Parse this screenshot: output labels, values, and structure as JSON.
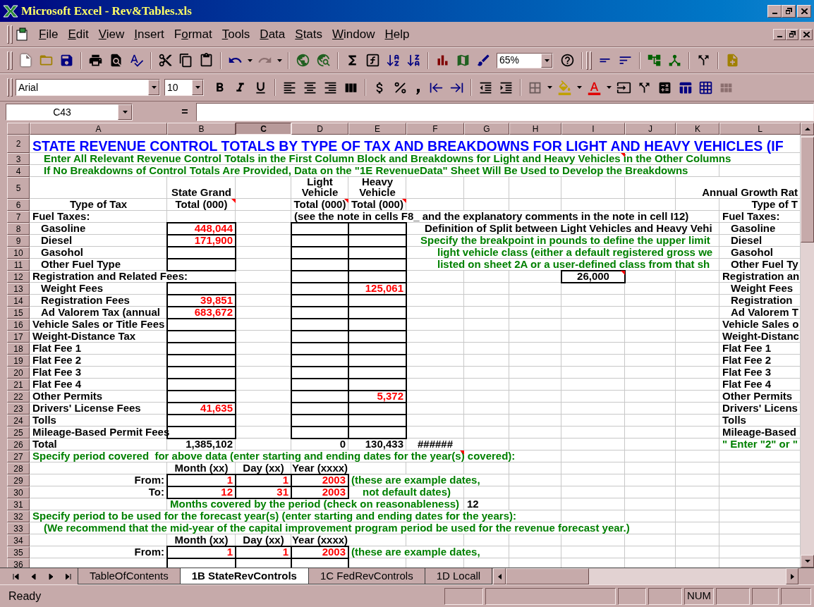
{
  "window": {
    "title": "Microsoft Excel - Rev&Tables.xls"
  },
  "menu": [
    {
      "key": "F",
      "post": "ile"
    },
    {
      "key": "E",
      "post": "dit"
    },
    {
      "key": "V",
      "post": "iew"
    },
    {
      "key": "I",
      "post": "nsert"
    },
    {
      "pre": "F",
      "key": "o",
      "post": "rmat"
    },
    {
      "key": "T",
      "post": "ools"
    },
    {
      "key": "D",
      "post": "ata"
    },
    {
      "key": "S",
      "post": "tats"
    },
    {
      "key": "W",
      "post": "indow"
    },
    {
      "key": "H",
      "post": "elp"
    }
  ],
  "standard_toolbar": {
    "zoom": "65%",
    "redo_disabled": true
  },
  "formatting_toolbar": {
    "font": "Arial",
    "size": "10"
  },
  "formula_bar": {
    "name_box": "C43",
    "edit_button": "="
  },
  "columns": [
    {
      "label": "A",
      "selected": false
    },
    {
      "label": "B",
      "selected": false
    },
    {
      "label": "C",
      "selected": true
    },
    {
      "label": "D",
      "selected": false
    },
    {
      "label": "E",
      "selected": false
    },
    {
      "label": "F",
      "selected": false
    },
    {
      "label": "G",
      "selected": false
    },
    {
      "label": "H",
      "selected": false
    },
    {
      "label": "I",
      "selected": false
    },
    {
      "label": "J",
      "selected": false
    },
    {
      "label": "K",
      "selected": false
    },
    {
      "label": "L",
      "selected": false
    }
  ],
  "rows": [
    {
      "label": "2",
      "cells": {
        "A": {
          "kind": "title",
          "text": "STATE REVENUE CONTROL TOTALS BY TYPE OF TAX AND BREAKDOWNS FOR LIGHT AND HEAVY VEHICLES (IF"
        }
      }
    },
    {
      "label": "3",
      "cells": {
        "A": {
          "kind": "note2",
          "text": "Enter All Relevant Revenue Control Totals in the First Column Block and Breakdowns for Light and Heavy Vehicles in the Other Columns"
        },
        "I": {
          "comment": true
        }
      }
    },
    {
      "label": "4",
      "cells": {
        "A": {
          "kind": "note2",
          "text": "If No Breakdowns of Control Totals Are Provided, Data on the \"1E RevenueData\" Sheet Will Be Used to Develop the Breakdowns"
        }
      }
    },
    {
      "label": "5",
      "cells": {
        "B": {
          "kind": "heading",
          "text": "State Grand"
        },
        "D": {
          "kind": "heading",
          "text": "Light\nVehicle"
        },
        "E": {
          "kind": "heading",
          "text": "Heavy\nVehicle"
        },
        "L": {
          "kind": "rlabel",
          "text": "Annual Growth Rat"
        }
      }
    },
    {
      "label": "6",
      "cells": {
        "A": {
          "kind": "heading",
          "text": "Type of Tax"
        },
        "B": {
          "kind": "heading",
          "text": "Total (000)",
          "comment": true
        },
        "D": {
          "kind": "heading",
          "text": "Total (000)",
          "comment": true
        },
        "E": {
          "kind": "heading",
          "text": "Total (000)",
          "comment": true
        },
        "L": {
          "kind": "rlabel",
          "text": "Type of T"
        }
      }
    },
    {
      "label": "7",
      "cells": {
        "A": {
          "kind": "label",
          "text": "Fuel Taxes:"
        },
        "D": {
          "kind": "label",
          "text": "(see the note in cells F8_ and the explanatory comments in the note in cell I12)"
        },
        "L": {
          "kind": "label",
          "text": "Fuel Taxes:"
        }
      }
    },
    {
      "label": "8",
      "cells": {
        "A": {
          "kind": "label2",
          "text": "Gasoline"
        },
        "B": {
          "kind": "input",
          "text": "448,044"
        },
        "D": {
          "kind": "input"
        },
        "E": {
          "kind": "input"
        },
        "F": {
          "kind": "label3",
          "text": "Definition of Split between Light Vehicles and Heavy Vehi"
        },
        "L": {
          "kind": "label2",
          "text": "Gasoline"
        }
      }
    },
    {
      "label": "9",
      "cells": {
        "A": {
          "kind": "label2",
          "text": "Diesel"
        },
        "B": {
          "kind": "input",
          "text": "171,900"
        },
        "D": {
          "kind": "input"
        },
        "E": {
          "kind": "input"
        },
        "F": {
          "kind": "note2",
          "text": "Specify the breakpoint in pounds to define the upper limit"
        },
        "L": {
          "kind": "label2",
          "text": "Diesel"
        }
      }
    },
    {
      "label": "10",
      "cells": {
        "A": {
          "kind": "label2",
          "text": "Gasohol"
        },
        "B": {
          "kind": "input"
        },
        "D": {
          "kind": "input"
        },
        "E": {
          "kind": "input"
        },
        "F": {
          "kind": "note3",
          "text": "light vehicle class (either a default registered gross we"
        },
        "L": {
          "kind": "label2",
          "text": "Gasohol"
        }
      }
    },
    {
      "label": "11",
      "cells": {
        "A": {
          "kind": "label2",
          "text": "Other Fuel Type"
        },
        "B": {
          "kind": "input"
        },
        "D": {
          "kind": "input"
        },
        "E": {
          "kind": "input"
        },
        "F": {
          "kind": "note3",
          "text": "listed on sheet 2A or a user-defined class from that sh"
        },
        "L": {
          "kind": "label2",
          "text": "Other Fuel Ty"
        }
      }
    },
    {
      "label": "12",
      "cells": {
        "A": {
          "kind": "label",
          "text": "Registration and Related Fees:"
        },
        "D": {
          "kind": "input"
        },
        "E": {
          "kind": "input"
        },
        "I": {
          "kind": "input-center",
          "text": "26,000",
          "comment": true
        },
        "L": {
          "kind": "label",
          "text": "Registration an"
        }
      }
    },
    {
      "label": "13",
      "cells": {
        "A": {
          "kind": "label2",
          "text": "Weight Fees"
        },
        "B": {
          "kind": "input"
        },
        "D": {
          "kind": "input"
        },
        "E": {
          "kind": "input",
          "text": "125,061"
        },
        "L": {
          "kind": "label2",
          "text": "Weight Fees"
        }
      }
    },
    {
      "label": "14",
      "cells": {
        "A": {
          "kind": "label2",
          "text": "Registration Fees"
        },
        "B": {
          "kind": "input",
          "text": "39,851"
        },
        "D": {
          "kind": "input"
        },
        "E": {
          "kind": "input"
        },
        "L": {
          "kind": "label2",
          "text": "Registration"
        }
      }
    },
    {
      "label": "15",
      "cells": {
        "A": {
          "kind": "label2",
          "text": "Ad Valorem Tax (annual"
        },
        "B": {
          "kind": "input",
          "text": "683,672"
        },
        "D": {
          "kind": "input"
        },
        "E": {
          "kind": "input"
        },
        "L": {
          "kind": "label2",
          "text": "Ad Valorem T"
        }
      }
    },
    {
      "label": "16",
      "cells": {
        "A": {
          "kind": "label",
          "text": "Vehicle Sales or Title Fees"
        },
        "B": {
          "kind": "input"
        },
        "D": {
          "kind": "input"
        },
        "E": {
          "kind": "input"
        },
        "L": {
          "kind": "label",
          "text": "Vehicle Sales o"
        }
      }
    },
    {
      "label": "17",
      "cells": {
        "A": {
          "kind": "label",
          "text": "Weight-Distance Tax"
        },
        "B": {
          "kind": "input"
        },
        "D": {
          "kind": "input"
        },
        "E": {
          "kind": "input"
        },
        "L": {
          "kind": "label",
          "text": "Weight-Distanc"
        }
      }
    },
    {
      "label": "18",
      "cells": {
        "A": {
          "kind": "label",
          "text": "Flat Fee 1"
        },
        "B": {
          "kind": "input"
        },
        "D": {
          "kind": "input"
        },
        "E": {
          "kind": "input"
        },
        "L": {
          "kind": "label",
          "text": "Flat Fee 1"
        }
      }
    },
    {
      "label": "19",
      "cells": {
        "A": {
          "kind": "label",
          "text": "Flat Fee 2"
        },
        "B": {
          "kind": "input"
        },
        "D": {
          "kind": "input"
        },
        "E": {
          "kind": "input"
        },
        "L": {
          "kind": "label",
          "text": "Flat Fee 2"
        }
      }
    },
    {
      "label": "20",
      "cells": {
        "A": {
          "kind": "label",
          "text": "Flat Fee 3"
        },
        "B": {
          "kind": "input"
        },
        "D": {
          "kind": "input"
        },
        "E": {
          "kind": "input"
        },
        "L": {
          "kind": "label",
          "text": "Flat Fee 3"
        }
      }
    },
    {
      "label": "21",
      "cells": {
        "A": {
          "kind": "label",
          "text": "Flat Fee 4"
        },
        "B": {
          "kind": "input"
        },
        "D": {
          "kind": "input"
        },
        "E": {
          "kind": "input"
        },
        "L": {
          "kind": "label",
          "text": "Flat Fee 4"
        }
      }
    },
    {
      "label": "22",
      "cells": {
        "A": {
          "kind": "label",
          "text": "Other Permits"
        },
        "B": {
          "kind": "input"
        },
        "D": {
          "kind": "input"
        },
        "E": {
          "kind": "input",
          "text": "5,372"
        },
        "L": {
          "kind": "label",
          "text": "Other Permits"
        }
      }
    },
    {
      "label": "23",
      "cells": {
        "A": {
          "kind": "label",
          "text": "Drivers' License Fees"
        },
        "B": {
          "kind": "input",
          "text": "41,635"
        },
        "D": {
          "kind": "input"
        },
        "E": {
          "kind": "input"
        },
        "L": {
          "kind": "label",
          "text": "Drivers' Licens"
        }
      }
    },
    {
      "label": "24",
      "cells": {
        "A": {
          "kind": "label",
          "text": "Tolls"
        },
        "B": {
          "kind": "input"
        },
        "D": {
          "kind": "input"
        },
        "E": {
          "kind": "input"
        },
        "L": {
          "kind": "label",
          "text": "Tolls"
        }
      }
    },
    {
      "label": "25",
      "cells": {
        "A": {
          "kind": "label",
          "text": "Mileage-Based Permit Fees"
        },
        "B": {
          "kind": "input"
        },
        "D": {
          "kind": "input"
        },
        "E": {
          "kind": "input"
        },
        "L": {
          "kind": "label",
          "text": "Mileage-Based"
        }
      }
    },
    {
      "label": "26",
      "cells": {
        "A": {
          "kind": "label",
          "text": "Total"
        },
        "B": {
          "kind": "value",
          "text": "1,385,102"
        },
        "D": {
          "kind": "value",
          "text": "0"
        },
        "E": {
          "kind": "value",
          "text": "130,433"
        },
        "F": {
          "kind": "center",
          "text": "######"
        },
        "L": {
          "kind": "note",
          "text": "\" Enter \"2\" or \""
        }
      }
    },
    {
      "label": "27",
      "cells": {
        "A": {
          "kind": "note",
          "text": "Specify period covered  for above data (enter starting and ending dates for the year(s) covered):"
        },
        "F": {
          "comment": true
        }
      }
    },
    {
      "label": "28",
      "cells": {
        "B": {
          "kind": "heading",
          "text": "Month (xx)"
        },
        "C": {
          "kind": "heading",
          "text": "Day (xx)"
        },
        "D": {
          "kind": "heading",
          "text": "Year (xxxx)"
        }
      }
    },
    {
      "label": "29",
      "cells": {
        "A": {
          "kind": "rlabel",
          "text": "From:"
        },
        "B": {
          "kind": "input",
          "text": "1"
        },
        "C": {
          "kind": "input",
          "text": "1"
        },
        "D": {
          "kind": "input",
          "text": "2003"
        },
        "E": {
          "kind": "note",
          "text": "(these are example dates,"
        }
      }
    },
    {
      "label": "30",
      "cells": {
        "A": {
          "kind": "rlabel",
          "text": "To:"
        },
        "B": {
          "kind": "input",
          "text": "12"
        },
        "C": {
          "kind": "input",
          "text": "31"
        },
        "D": {
          "kind": "input",
          "text": "2003"
        },
        "E": {
          "kind": "note2",
          "text": "not default dates)"
        }
      }
    },
    {
      "label": "31",
      "cells": {
        "B": {
          "kind": "note",
          "text": "Months covered by the period (check on reasonableness)"
        },
        "G": {
          "kind": "lvalue",
          "text": "12"
        }
      }
    },
    {
      "label": "32",
      "cells": {
        "A": {
          "kind": "note",
          "text": "Specify period to be used for the forecast year(s) (enter starting and ending dates for the years):"
        }
      }
    },
    {
      "label": "33",
      "cells": {
        "A": {
          "kind": "note2",
          "text": "(We recommend that the mid-year of the capital improvement program period be used for the revenue forecast year.)"
        }
      }
    },
    {
      "label": "34",
      "cells": {
        "B": {
          "kind": "heading",
          "text": "Month (xx)"
        },
        "C": {
          "kind": "heading",
          "text": "Day (xx)"
        },
        "D": {
          "kind": "heading",
          "text": "Year (xxxx)"
        }
      }
    },
    {
      "label": "35",
      "cells": {
        "A": {
          "kind": "rlabel",
          "text": "From:"
        },
        "B": {
          "kind": "input",
          "text": "1"
        },
        "C": {
          "kind": "input",
          "text": "1"
        },
        "D": {
          "kind": "input",
          "text": "2003"
        },
        "E": {
          "kind": "note",
          "text": "(these are example dates,"
        }
      }
    },
    {
      "label": "36",
      "cells": {
        "B": {
          "kind": "input"
        },
        "C": {
          "kind": "input"
        },
        "D": {
          "kind": "input"
        }
      }
    }
  ],
  "sheet_tabs": [
    {
      "label": "TableOfContents",
      "selected": false
    },
    {
      "label": "1B StateRevControls",
      "selected": true
    },
    {
      "label": "1C FedRevControls",
      "selected": false
    },
    {
      "label": "1D Locall",
      "selected": false
    }
  ],
  "status_bar": {
    "message": "Ready",
    "num_lock": "NUM"
  }
}
